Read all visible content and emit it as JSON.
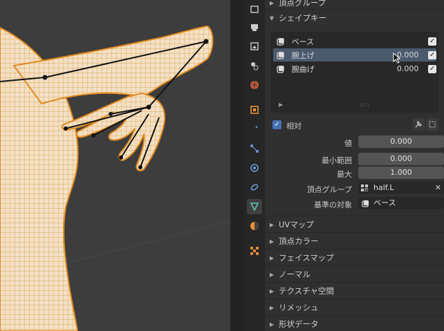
{
  "panels_above": [
    {
      "label": "頂点グループ"
    }
  ],
  "shape_keys": {
    "header": "シェイプキー",
    "items": [
      {
        "name": "ベース",
        "value": "",
        "checked": true
      },
      {
        "name": "腕上げ",
        "value": "0.000",
        "checked": true,
        "selected": true
      },
      {
        "name": "腕曲げ",
        "value": "0.000",
        "checked": true
      }
    ],
    "relative_label": "相対",
    "value_label": "値",
    "value": "0.000",
    "min_label": "最小範囲",
    "min": "0.000",
    "max_label": "最大",
    "max": "1.000",
    "vgroup_label": "頂点グループ",
    "vgroup": "half.L",
    "relative_to_label": "基準の対象",
    "relative_to": "ベース"
  },
  "panels_below": [
    {
      "label": "UVマップ"
    },
    {
      "label": "頂点カラー"
    },
    {
      "label": "フェイスマップ"
    },
    {
      "label": "ノーマル"
    },
    {
      "label": "テクスチャ空間"
    },
    {
      "label": "リメッシュ"
    },
    {
      "label": "形状データ"
    }
  ],
  "tabs": [
    "tool-icon",
    "render-icon",
    "output-icon",
    "view-layer-icon",
    "scene-icon",
    "world-icon",
    "object-icon",
    "modifier-icon",
    "particles-icon",
    "physics-icon",
    "constraints-icon",
    "mesh-data-icon",
    "material-icon",
    "texture-icon"
  ],
  "colors": {
    "accent": "#4772b3",
    "selection": "#4a5a6e",
    "wire": "#e08a1e",
    "mesh_fill": "#f0dcc0"
  }
}
